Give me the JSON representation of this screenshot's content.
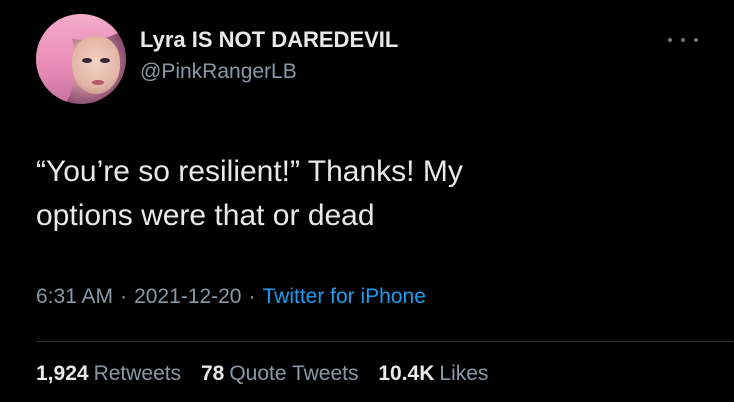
{
  "user": {
    "display_name": "Lyra IS NOT DAREDEVIL",
    "handle": "@PinkRangerLB",
    "avatar": "profile-photo-pink-hair"
  },
  "menu_icon": "more-horizontal-icon",
  "tweet": {
    "text_lines": [
      "“You’re so resilient!” Thanks! My",
      "options were that or dead"
    ],
    "time": "6:31 AM",
    "date": "2021-12-20",
    "separator": "·",
    "source": "Twitter for iPhone"
  },
  "stats": {
    "retweets_count": "1,924",
    "retweets_label": "Retweets",
    "quotes_count": "78",
    "quotes_label": "Quote Tweets",
    "likes_count": "10.4K",
    "likes_label": "Likes"
  },
  "colors": {
    "background": "#000000",
    "text_primary": "#e7e9ea",
    "text_secondary": "#8b98a5",
    "link": "#1d9bf0",
    "divider": "#2f3336"
  }
}
